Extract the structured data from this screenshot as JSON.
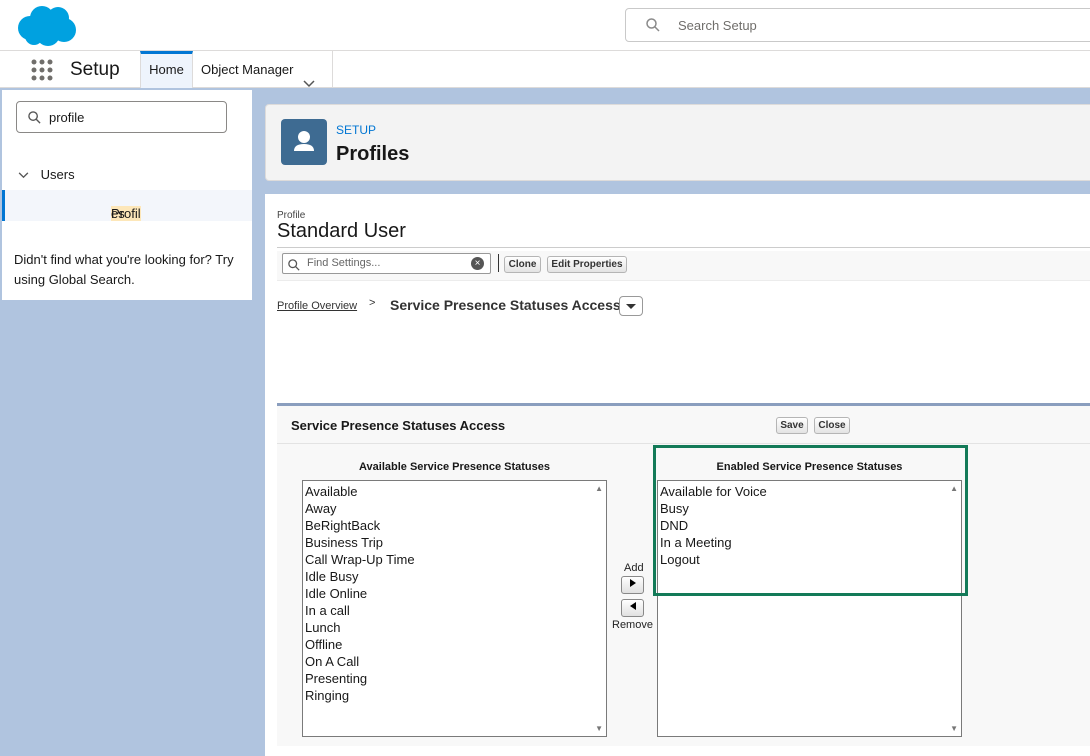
{
  "header": {
    "search_placeholder": "Search Setup"
  },
  "nav": {
    "app_name": "Setup",
    "tab_home": "Home",
    "tab_object_manager": "Object Manager"
  },
  "sidebar": {
    "quickfind_value": "profile",
    "group_label": "Users",
    "item_label_hl": "Profil",
    "item_label_rest": "es",
    "not_found_text": "Didn't find what you're looking for? Try using Global Search."
  },
  "page_header": {
    "eyebrow": "SETUP",
    "title": "Profiles"
  },
  "profile": {
    "label": "Profile",
    "name": "Standard User",
    "find_placeholder": "Find Settings...",
    "clone_label": "Clone",
    "edit_properties_label": "Edit Properties"
  },
  "breadcrumb": {
    "overview": "Profile Overview",
    "separator": ">",
    "current": "Service Presence Statuses Access"
  },
  "section": {
    "title": "Service Presence Statuses Access",
    "save_label": "Save",
    "close_label": "Close",
    "available_heading": "Available Service Presence Statuses",
    "enabled_heading": "Enabled Service Presence Statuses",
    "add_label": "Add",
    "remove_label": "Remove",
    "available": [
      "Available",
      "Away",
      "BeRightBack",
      "Business Trip",
      "Call Wrap-Up Time",
      "Idle Busy",
      "Idle Online",
      "In a call",
      "Lunch",
      "Offline",
      "On A Call",
      "Presenting",
      "Ringing"
    ],
    "enabled": [
      "Available for Voice",
      "Busy",
      "DND",
      "In a Meeting",
      "Logout"
    ]
  },
  "colors": {
    "brand_blue": "#0176d3",
    "highlight_border": "#137a58"
  }
}
